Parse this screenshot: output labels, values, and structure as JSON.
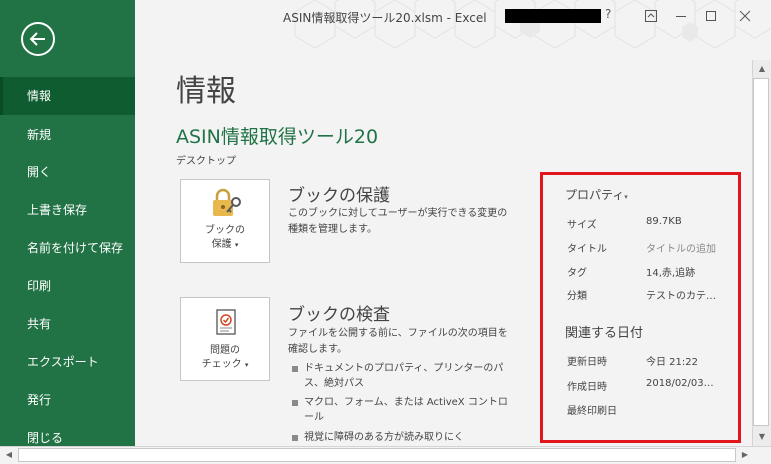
{
  "window": {
    "title": "ASIN情報取得ツール20.xlsm  -  Excel",
    "help": "?"
  },
  "nav": {
    "items": [
      {
        "label": "情報",
        "active": true
      },
      {
        "label": "新規"
      },
      {
        "label": "開く"
      },
      {
        "label": "上書き保存"
      },
      {
        "label": "名前を付けて保存"
      },
      {
        "label": "印刷"
      },
      {
        "label": "共有"
      },
      {
        "label": "エクスポート"
      },
      {
        "label": "発行"
      },
      {
        "label": "閉じる"
      }
    ]
  },
  "main": {
    "page_title": "情報",
    "doc_name": "ASIN情報取得ツール20",
    "doc_location": "デスクトップ",
    "protect": {
      "tile_line1": "ブックの",
      "tile_line2": "保護",
      "heading": "ブックの保護",
      "desc": "このブックに対してユーザーが実行できる変更の種類を管理します。"
    },
    "inspect": {
      "tile_line1": "問題の",
      "tile_line2": "チェック",
      "heading": "ブックの検査",
      "desc": "ファイルを公開する前に、ファイルの次の項目を確認します。",
      "bullets": [
        "ドキュメントのプロパティ、プリンターのパス、絶対パス",
        "マクロ、フォーム、または ActiveX コントロール",
        "視覚に障碍のある方が読み取りにく"
      ]
    }
  },
  "properties": {
    "heading": "プロパティ",
    "rows": [
      {
        "label": "サイズ",
        "value": "89.7KB"
      },
      {
        "label": "タイトル",
        "value": "タイトルの追加"
      },
      {
        "label": "タグ",
        "value": "14,赤,追跡"
      },
      {
        "label": "分類",
        "value": "テストのカテ…"
      }
    ],
    "dates_heading": "関連する日付",
    "dates": [
      {
        "label": "更新日時",
        "value": "今日 21:22"
      },
      {
        "label": "作成日時",
        "value": "2018/02/03…"
      },
      {
        "label": "最終印刷日",
        "value": ""
      }
    ]
  },
  "colors": {
    "accent": "#217346",
    "nav_active": "#0e5c2f",
    "highlight_border": "#e0161c"
  },
  "icons": {
    "back": "back-arrow-icon",
    "protect": "lock-key-icon",
    "inspect": "check-document-icon"
  }
}
